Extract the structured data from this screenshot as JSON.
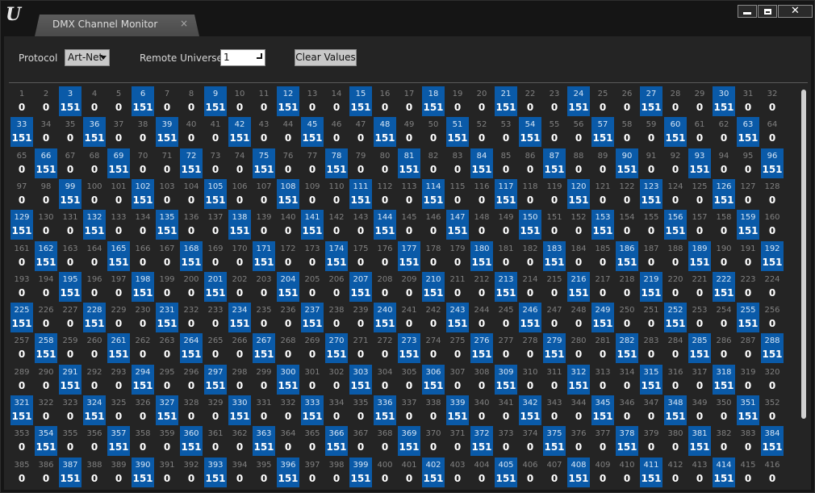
{
  "window": {
    "tab_title": "DMX Channel Monitor",
    "tab_close": "×",
    "buttons": {
      "minimize": "",
      "maximize": "",
      "close": "✕"
    }
  },
  "toolbar": {
    "protocol_label": "Protocol",
    "protocol_value": "Art-Net",
    "universe_label": "Remote Universe",
    "universe_value": "1",
    "clear_label": "Clear Values"
  },
  "monitor": {
    "channel_start": 1,
    "channel_end": 416,
    "columns": 32,
    "active_every": 3,
    "active_value": "151",
    "inactive_value": "0",
    "highlight_color": "#0a5aa8"
  }
}
